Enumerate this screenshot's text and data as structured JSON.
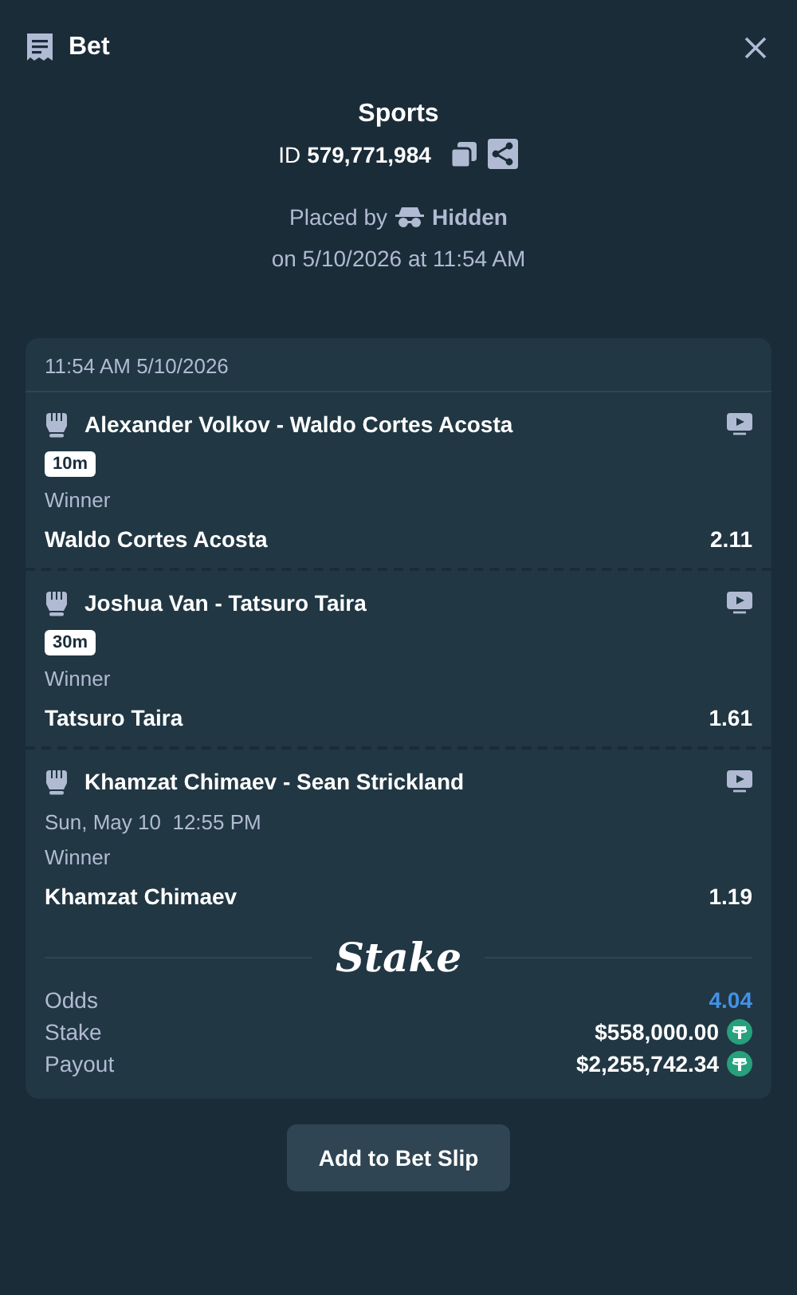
{
  "header": {
    "title": "Bet"
  },
  "summary": {
    "title": "Sports",
    "id_label": "ID",
    "id_value": "579,771,984",
    "placed_by_label": "Placed by",
    "placed_by_user": "Hidden",
    "placed_on": "on 5/10/2026 at 11:54 AM"
  },
  "slip": {
    "timestamp": "11:54 AM 5/10/2026",
    "legs": [
      {
        "event": "Alexander Volkov - Waldo Cortes Acosta",
        "kind": "badge",
        "info": "10m",
        "market": "Winner",
        "selection": "Waldo Cortes Acosta",
        "odds": "2.11"
      },
      {
        "event": "Joshua Van - Tatsuro Taira",
        "kind": "badge",
        "info": "30m",
        "market": "Winner",
        "selection": "Tatsuro Taira",
        "odds": "1.61"
      },
      {
        "event": "Khamzat Chimaev - Sean Strickland",
        "kind": "date",
        "info": "Sun, May 10  12:55 PM",
        "market": "Winner",
        "selection": "Khamzat Chimaev",
        "odds": "1.19"
      }
    ],
    "brand": "Stake",
    "totals": [
      {
        "label": "Odds",
        "value": "4.04",
        "kind": "odds"
      },
      {
        "label": "Stake",
        "value": "$558,000.00",
        "kind": "currency"
      },
      {
        "label": "Payout",
        "value": "$2,255,742.34",
        "kind": "currency"
      }
    ]
  },
  "button": "Add to Bet Slip"
}
